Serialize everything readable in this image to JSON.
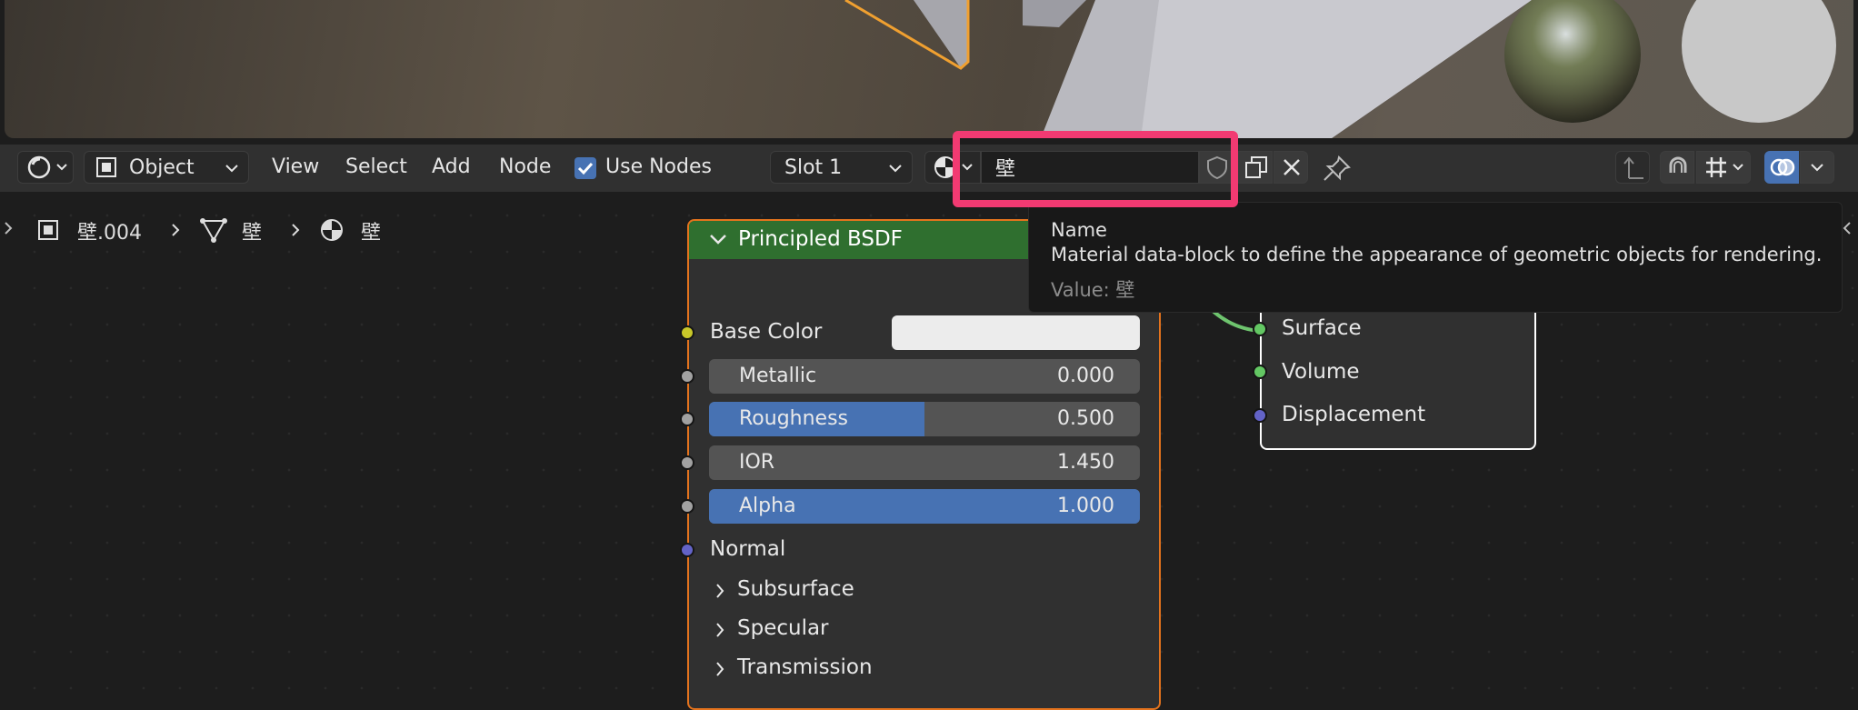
{
  "header": {
    "editor_type_icon": "shader-editor-icon",
    "mode_label": "Object",
    "menus": [
      "View",
      "Select",
      "Add",
      "Node"
    ],
    "use_nodes_label": "Use Nodes",
    "use_nodes_checked": true,
    "slot_label": "Slot 1",
    "material_name": "壁"
  },
  "breadcrumb": {
    "object": "壁.004",
    "mesh": "壁",
    "material": "壁"
  },
  "bsdf_node": {
    "title": "Principled BSDF",
    "base_color_label": "Base Color",
    "normal_label": "Normal",
    "fields": [
      {
        "label": "Metallic",
        "value": "0.000",
        "fill": 0.0
      },
      {
        "label": "Roughness",
        "value": "0.500",
        "fill": 0.5
      },
      {
        "label": "IOR",
        "value": "1.450",
        "fill": 0.0
      },
      {
        "label": "Alpha",
        "value": "1.000",
        "fill": 1.0
      }
    ],
    "panels": [
      "Subsurface",
      "Specular",
      "Transmission"
    ]
  },
  "output_node": {
    "sockets": [
      "Surface",
      "Volume",
      "Displacement"
    ]
  },
  "tooltip": {
    "title": "Name",
    "description": "Material data-block to define the appearance of geometric objects for rendering.",
    "value": "Value: 壁"
  },
  "colors": {
    "accent_blue": "#4772b3",
    "node_header_green": "#2f6f2f",
    "selection_orange": "#e4731d",
    "highlight_pink": "#f23a72"
  }
}
